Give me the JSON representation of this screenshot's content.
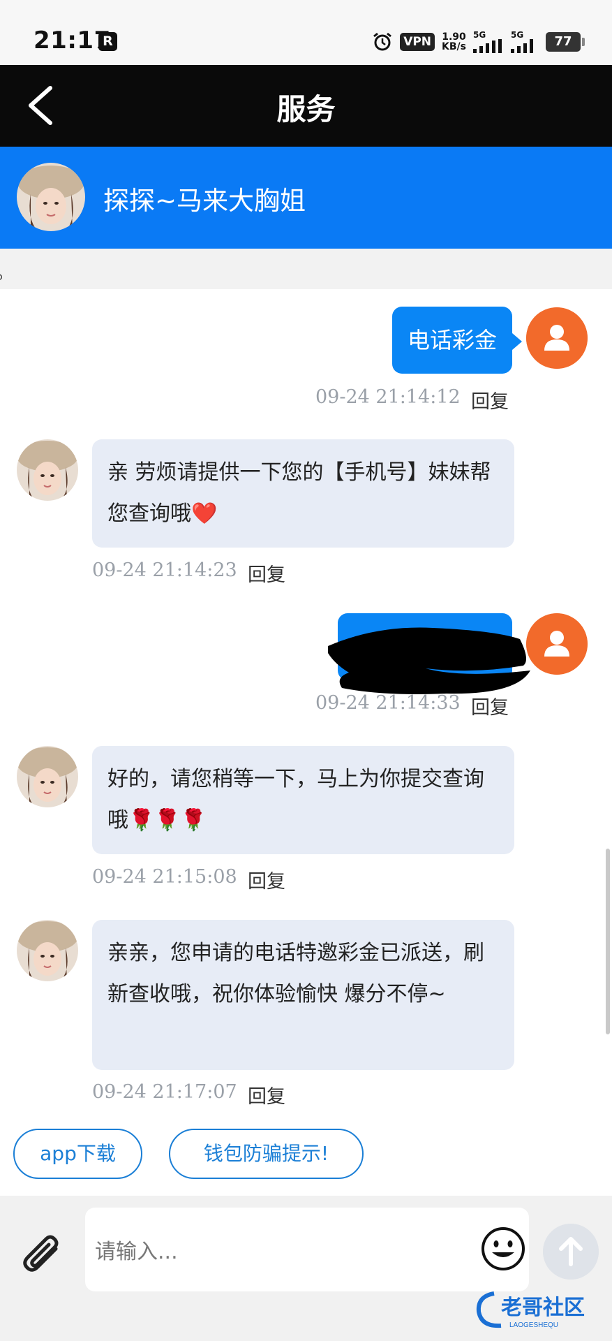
{
  "status_bar": {
    "time": "21:17",
    "r_badge": "R",
    "vpn": "VPN",
    "speed_value": "1.90",
    "speed_unit": "KB/s",
    "sig1": "5G",
    "sig2": "5G",
    "battery": "77"
  },
  "header": {
    "title": "服务"
  },
  "agent": {
    "name": "探探~马来大胸姐"
  },
  "notice": {
    "text": "。"
  },
  "messages": [
    {
      "from": "user",
      "text": "电话彩金",
      "time": "09-24 21:14:12",
      "reply": "回复"
    },
    {
      "from": "agent",
      "text": "亲 劳烦请提供一下您的【手机号】妹妹帮您查询哦❤️",
      "time": "09-24 21:14:23",
      "reply": "回复"
    },
    {
      "from": "user",
      "text": "",
      "time": "09-24 21:14:33",
      "reply": "回复"
    },
    {
      "from": "agent",
      "text": "好的，请您稍等一下，马上为你提交查询哦🌹🌹🌹",
      "time": "09-24 21:15:08",
      "reply": "回复"
    },
    {
      "from": "agent",
      "text": "亲亲，您申请的电话特邀彩金已派送，刷新查收哦，祝你体验愉快 爆分不停~",
      "time": "09-24 21:17:07",
      "reply": "回复"
    }
  ],
  "quick_actions": [
    {
      "label": "app下载"
    },
    {
      "label": "钱包防骗提示!"
    }
  ],
  "input": {
    "placeholder": "请输入..."
  },
  "watermark": {
    "text": "老哥社区",
    "sub": "LAOGESHEQU"
  },
  "colors": {
    "header_bg": "#0a0a0a",
    "agent_bar_bg": "#0a7af5",
    "user_bubble": "#0a86f5",
    "agent_bubble": "#e7ecf6",
    "user_avatar": "#f26a2b",
    "accent": "#1b7fd6"
  },
  "icons": [
    "back-arrow-icon",
    "alarm-icon",
    "signal-icon",
    "battery-icon",
    "user-icon",
    "paperclip-icon",
    "emoji-icon",
    "send-arrow-icon"
  ]
}
